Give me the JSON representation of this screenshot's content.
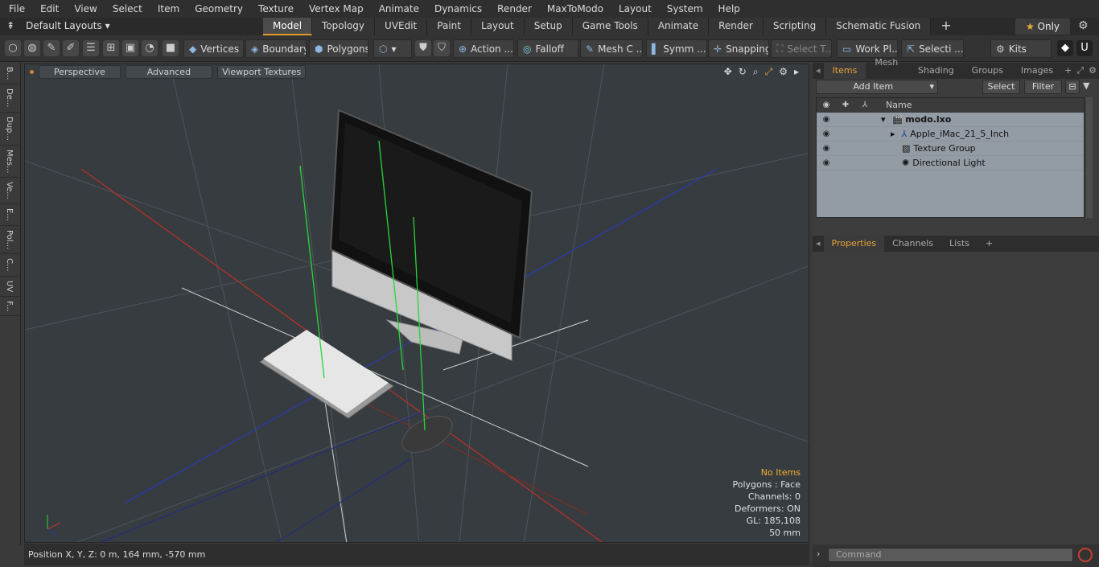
{
  "menu": [
    "File",
    "Edit",
    "View",
    "Select",
    "Item",
    "Geometry",
    "Texture",
    "Vertex Map",
    "Animate",
    "Dynamics",
    "Render",
    "MaxToModo",
    "Layout",
    "System",
    "Help"
  ],
  "layout": {
    "label": "Default Layouts"
  },
  "modes": {
    "items": [
      "Model",
      "Topology",
      "UVEdit",
      "Paint",
      "Layout",
      "Setup",
      "Game Tools",
      "Animate",
      "Render",
      "Scripting",
      "Schematic Fusion"
    ],
    "active": "Model",
    "add": "+"
  },
  "only": {
    "label": "Only"
  },
  "toolbar": {
    "vertices": "Vertices",
    "boundary": "Boundary",
    "polygons": "Polygons",
    "action": "Action ...",
    "falloff": "Falloff",
    "mesh": "Mesh C ...",
    "symm": "Symm ...",
    "snapping": "Snapping",
    "select_t": "Select T...",
    "work_pl": "Work Pl...",
    "selecti": "Selecti ...",
    "kits": "Kits"
  },
  "left_tabs": [
    "B...",
    "De...",
    "Dup...",
    "Mes...",
    "Ve...",
    "E...",
    "Pol...",
    "C...",
    "UV",
    "F..."
  ],
  "viewport": {
    "perspective": "Perspective",
    "advanced": "Advanced",
    "textures": "Viewport Textures",
    "info": {
      "no_items": "No Items",
      "polygons": "Polygons : Face",
      "channels": "Channels: 0",
      "deformers": "Deformers: ON",
      "gl": "GL: 185,108",
      "focal": "50 mm"
    }
  },
  "status": {
    "position": "Position X, Y, Z:   0 m, 164 mm, -570 mm"
  },
  "panel": {
    "tabs": [
      "Items",
      "Mesh ...",
      "Shading",
      "Groups",
      "Images"
    ],
    "active": "Items",
    "add_item": "Add Item",
    "select": "Select",
    "filter": "Filter",
    "name_col": "Name",
    "tree": [
      "modo.lxo",
      "Apple_iMac_21_5_Inch",
      "Texture Group",
      "Directional Light"
    ]
  },
  "props": {
    "tabs": [
      "Properties",
      "Channels",
      "Lists"
    ],
    "active": "Properties",
    "add": "+"
  },
  "command": {
    "placeholder": "Command"
  },
  "colors": {
    "accent": "#e8a33a",
    "x_axis": "#c0392b",
    "y_axis": "#2ecc40",
    "z_axis": "#2233aa"
  }
}
